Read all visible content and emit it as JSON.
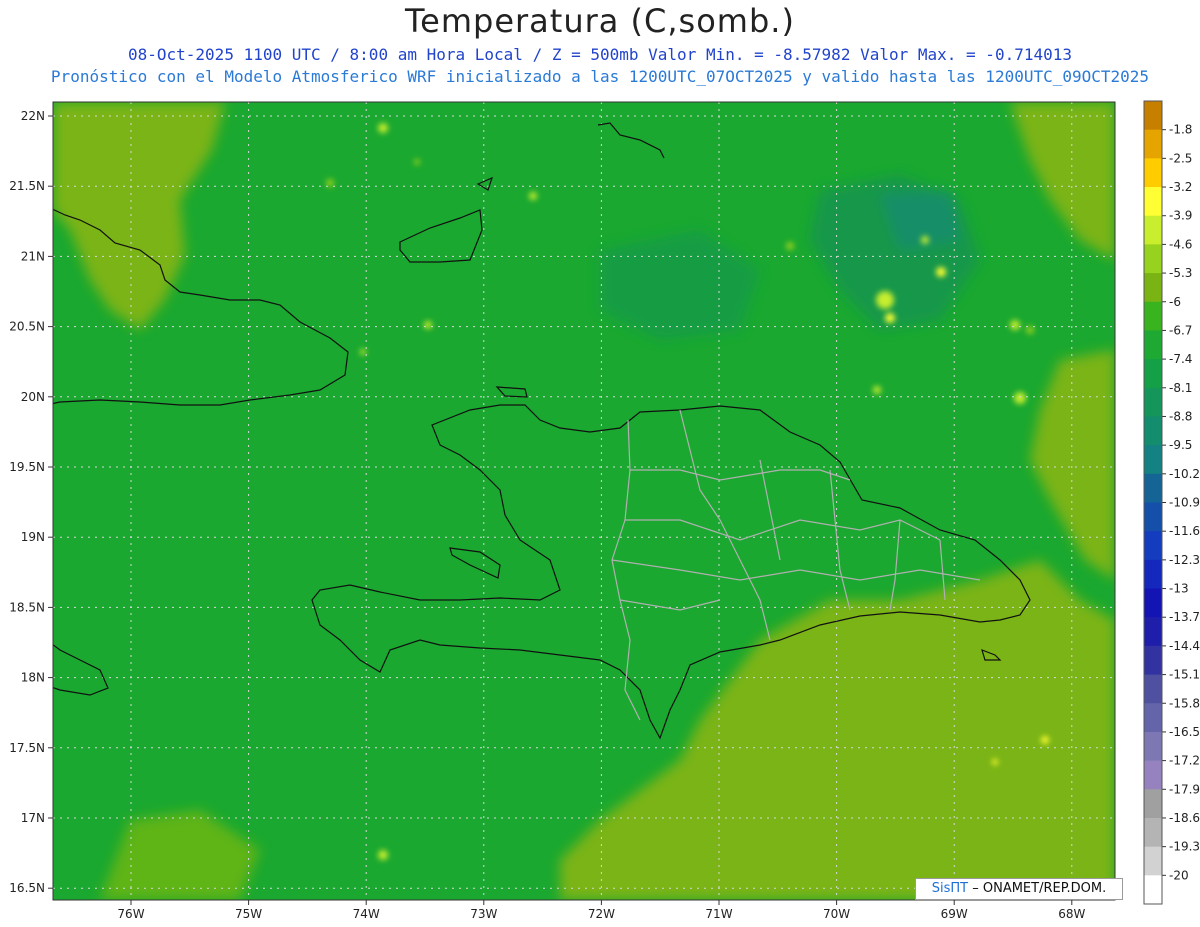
{
  "title": "Temperatura (C,somb.)",
  "subtitle_line1": "08-Oct-2025  1100 UTC / 8:00 am Hora Local / Z = 500mb  Valor Min. = -8.57982  Valor Max. = -0.714013",
  "subtitle_line2": "Pronóstico con el Modelo Atmosferico WRF inicializado a las 1200UTC_07OCT2025 y valido hasta las  1200UTC_09OCT2025",
  "lat_labels": [
    "22N",
    "21.5N",
    "21N",
    "20.5N",
    "20N",
    "19.5N",
    "19N",
    "18.5N",
    "18N",
    "17.5N",
    "17N",
    "16.5N"
  ],
  "lon_labels": [
    "76W",
    "75W",
    "74W",
    "73W",
    "72W",
    "71W",
    "70W",
    "69W",
    "68W"
  ],
  "colorbar": [
    {
      "label": "-1.8",
      "color": "#c77f00"
    },
    {
      "label": "-2.5",
      "color": "#e6a400"
    },
    {
      "label": "-3.2",
      "color": "#ffcc00"
    },
    {
      "label": "-3.9",
      "color": "#ffff33"
    },
    {
      "label": "-4.6",
      "color": "#c8ee2e"
    },
    {
      "label": "-5.3",
      "color": "#96d21e"
    },
    {
      "label": "-6",
      "color": "#7ab414"
    },
    {
      "label": "-6.7",
      "color": "#3ab41e"
    },
    {
      "label": "-7.4",
      "color": "#1eaa32"
    },
    {
      "label": "-8.1",
      "color": "#14a046"
    },
    {
      "label": "-8.8",
      "color": "#14965a"
    },
    {
      "label": "-9.5",
      "color": "#148c6e"
    },
    {
      "label": "-10.2",
      "color": "#148282"
    },
    {
      "label": "-10.9",
      "color": "#146496"
    },
    {
      "label": "-11.6",
      "color": "#1450aa"
    },
    {
      "label": "-12.3",
      "color": "#143cbe"
    },
    {
      "label": "-13",
      "color": "#1428be"
    },
    {
      "label": "-13.7",
      "color": "#1414b4"
    },
    {
      "label": "-14.4",
      "color": "#1e1eaa"
    },
    {
      "label": "-15.1",
      "color": "#3232a0"
    },
    {
      "label": "-15.8",
      "color": "#5050a0"
    },
    {
      "label": "-16.5",
      "color": "#6464aa"
    },
    {
      "label": "-17.2",
      "color": "#7d78b4"
    },
    {
      "label": "-17.9",
      "color": "#9682be"
    },
    {
      "label": "-18.6",
      "color": "#a0a0a0"
    },
    {
      "label": "-19.3",
      "color": "#b4b4b4"
    },
    {
      "label": "-20",
      "color": "#d2d2d2"
    },
    {
      "label": "",
      "color": "#ffffff"
    }
  ],
  "credit": {
    "logo": "SisПТ",
    "text": "– ONAMET/REP.DOM."
  }
}
